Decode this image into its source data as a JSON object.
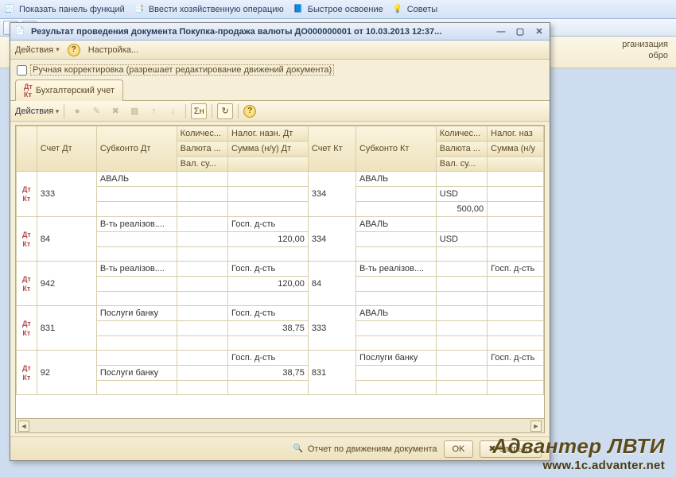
{
  "top_toolbar": {
    "show_panel": "Показать панель функций",
    "enter_operation": "Ввести хозяйственную операцию",
    "quick_learn": "Быстрое освоение",
    "tips": "Советы"
  },
  "bg_right": {
    "line1": "рганизация",
    "line2": "обро"
  },
  "modal": {
    "title": "Результат проведения документа Покупка-продажа валюты ДО000000001 от 10.03.2013 12:37...",
    "menubar": {
      "actions": "Действия",
      "settings": "Настройка..."
    },
    "manual_correction": "Ручная корректировка (разрешает редактирование движений документа)",
    "tab_label": "Бухгалтерский учет",
    "inner_actions": "Действия",
    "headers": {
      "account_dt": "Счет Дт",
      "subconto_dt": "Субконто Дт",
      "qty1": "Количес...",
      "tax_dt": "Налог. назн. Дт",
      "account_kt": "Счет Кт",
      "subconto_kt": "Субконто Кт",
      "qty2": "Количес...",
      "tax_kt": "Налог. наз",
      "currency": "Валюта ...",
      "sum_nu_dt": "Сумма (н/у) Дт",
      "val_sum": "Вал. су...",
      "sum_nu": "Сумма (н/у"
    },
    "rows": [
      {
        "acct_dt": "333",
        "sub_dt_1": "АВАЛЬ",
        "sub_dt_2": "",
        "sub_dt_3": "",
        "qty1": "",
        "tax_dt_1": "",
        "tax_dt_2": "",
        "tax_dt_3": "",
        "acct_kt": "334",
        "sub_kt_1": "АВАЛЬ",
        "sub_kt_2": "",
        "sub_kt_3": "",
        "qty2_1": "",
        "qty2_2": "USD",
        "qty2_3": "500,00",
        "tax_kt": ""
      },
      {
        "acct_dt": "84",
        "sub_dt_1": "В-ть реалізов....",
        "sub_dt_2": "",
        "sub_dt_3": "",
        "qty1": "",
        "tax_dt_1": "Госп. д-сть",
        "tax_dt_2": "120,00",
        "tax_dt_3": "",
        "acct_kt": "334",
        "sub_kt_1": "АВАЛЬ",
        "sub_kt_2": "",
        "sub_kt_3": "",
        "qty2_1": "",
        "qty2_2": "USD",
        "qty2_3": "",
        "tax_kt": ""
      },
      {
        "acct_dt": "942",
        "sub_dt_1": "В-ть реалізов....",
        "sub_dt_2": "",
        "sub_dt_3": "",
        "qty1": "",
        "tax_dt_1": "Госп. д-сть",
        "tax_dt_2": "120,00",
        "tax_dt_3": "",
        "acct_kt": "84",
        "sub_kt_1": "В-ть реалізов....",
        "sub_kt_2": "",
        "sub_kt_3": "",
        "qty2_1": "",
        "qty2_2": "",
        "qty2_3": "",
        "tax_kt": "Госп. д-сть"
      },
      {
        "acct_dt": "831",
        "sub_dt_1": "Послуги банку",
        "sub_dt_2": "",
        "sub_dt_3": "",
        "qty1": "",
        "tax_dt_1": "Госп. д-сть",
        "tax_dt_2": "38,75",
        "tax_dt_3": "",
        "acct_kt": "333",
        "sub_kt_1": "АВАЛЬ",
        "sub_kt_2": "",
        "sub_kt_3": "",
        "qty2_1": "",
        "qty2_2": "",
        "qty2_3": "",
        "tax_kt": ""
      },
      {
        "acct_dt": "92",
        "sub_dt_1": "",
        "sub_dt_2": "Послуги банку",
        "sub_dt_3": "",
        "qty1": "",
        "tax_dt_1": "Госп. д-сть",
        "tax_dt_2": "38,75",
        "tax_dt_3": "",
        "acct_kt": "831",
        "sub_kt_1": "Послуги банку",
        "sub_kt_2": "",
        "sub_kt_3": "",
        "qty2_1": "",
        "qty2_2": "",
        "qty2_3": "",
        "tax_kt": "Госп. д-сть"
      }
    ],
    "footer": {
      "report": "Отчет по движениям документа",
      "ok": "OK",
      "close": "Закрыть"
    }
  },
  "watermark": {
    "line1": "Адвантер ЛВТИ",
    "line2": "www.1c.advanter.net"
  }
}
